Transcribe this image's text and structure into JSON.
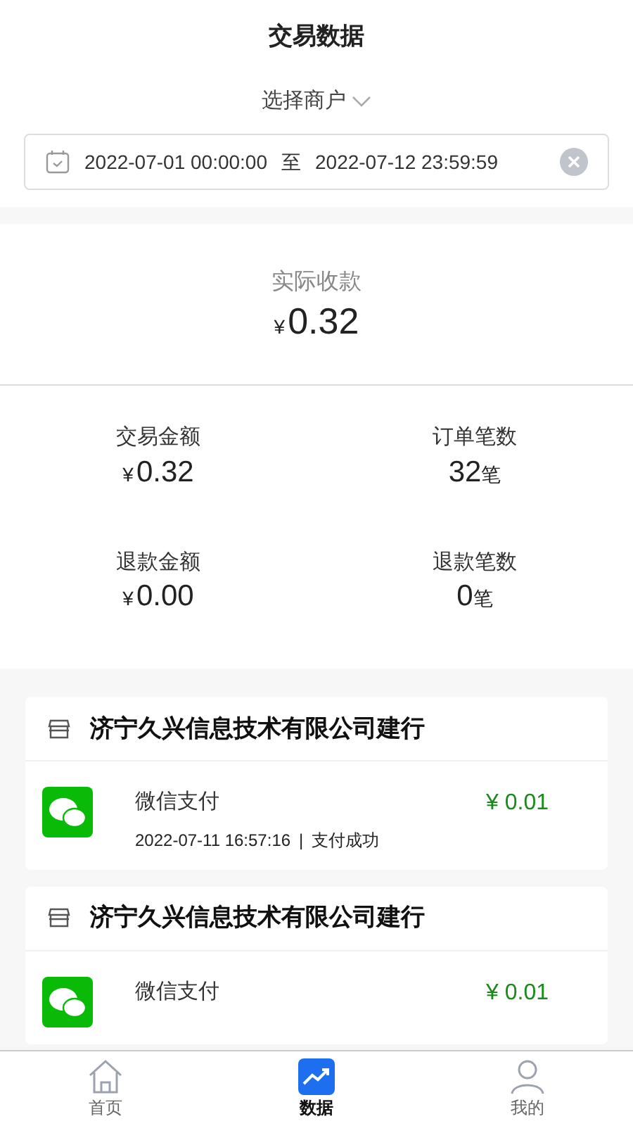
{
  "header": {
    "title": "交易数据"
  },
  "merchant_select": {
    "label": "选择商户"
  },
  "date_range": {
    "start": "2022-07-01 00:00:00",
    "separator": "至",
    "end": "2022-07-12 23:59:59"
  },
  "summary": {
    "label": "实际收款",
    "currency": "¥",
    "value": "0.32"
  },
  "stats": [
    {
      "label": "交易金额",
      "prefix": "¥",
      "value": "0.32"
    },
    {
      "label": "订单笔数",
      "value": "32",
      "suffix": "笔"
    },
    {
      "label": "退款金额",
      "prefix": "¥",
      "value": "0.00"
    },
    {
      "label": "退款笔数",
      "value": "0",
      "suffix": "笔"
    }
  ],
  "transactions": [
    {
      "merchant": "济宁久兴信息技术有限公司建行",
      "method": "微信支付",
      "time": "2022-07-11 16:57:16",
      "separator": "|",
      "status": "支付成功",
      "amount": "¥ 0.01"
    },
    {
      "merchant": "济宁久兴信息技术有限公司建行",
      "method": "微信支付",
      "amount": "¥ 0.01"
    }
  ],
  "tab_bar": [
    {
      "label": "首页",
      "kind": "home",
      "selected": false
    },
    {
      "label": "数据",
      "kind": "chart",
      "selected": true
    },
    {
      "label": "我的",
      "kind": "user",
      "selected": false
    }
  ]
}
